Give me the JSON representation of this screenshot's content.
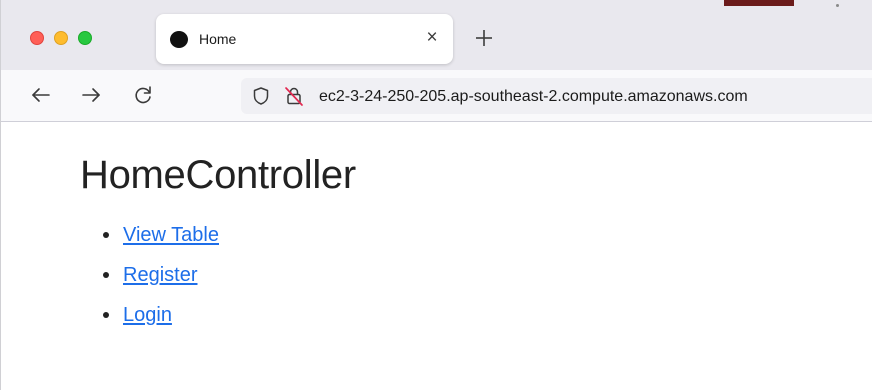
{
  "browser": {
    "tab": {
      "title": "Home",
      "close_glyph": "×",
      "favicon": "black-circle-favicon"
    },
    "new_tab_icon": "plus-icon",
    "nav": {
      "back_icon": "arrow-left-icon",
      "forward_icon": "arrow-right-icon",
      "reload_icon": "reload-icon"
    },
    "address_bar": {
      "url": "ec2-3-24-250-205.ap-southeast-2.compute.amazonaws.com",
      "shield_icon": "shield-icon",
      "insecure_lock_icon": "lock-crossed-icon"
    },
    "traffic_lights": {
      "close": "#ff5f57",
      "minimize": "#febc2e",
      "maximize": "#28c840"
    }
  },
  "page": {
    "heading": "HomeController",
    "links": [
      {
        "label": "View Table"
      },
      {
        "label": "Register"
      },
      {
        "label": "Login"
      }
    ],
    "link_color": "#1d6ee9"
  }
}
